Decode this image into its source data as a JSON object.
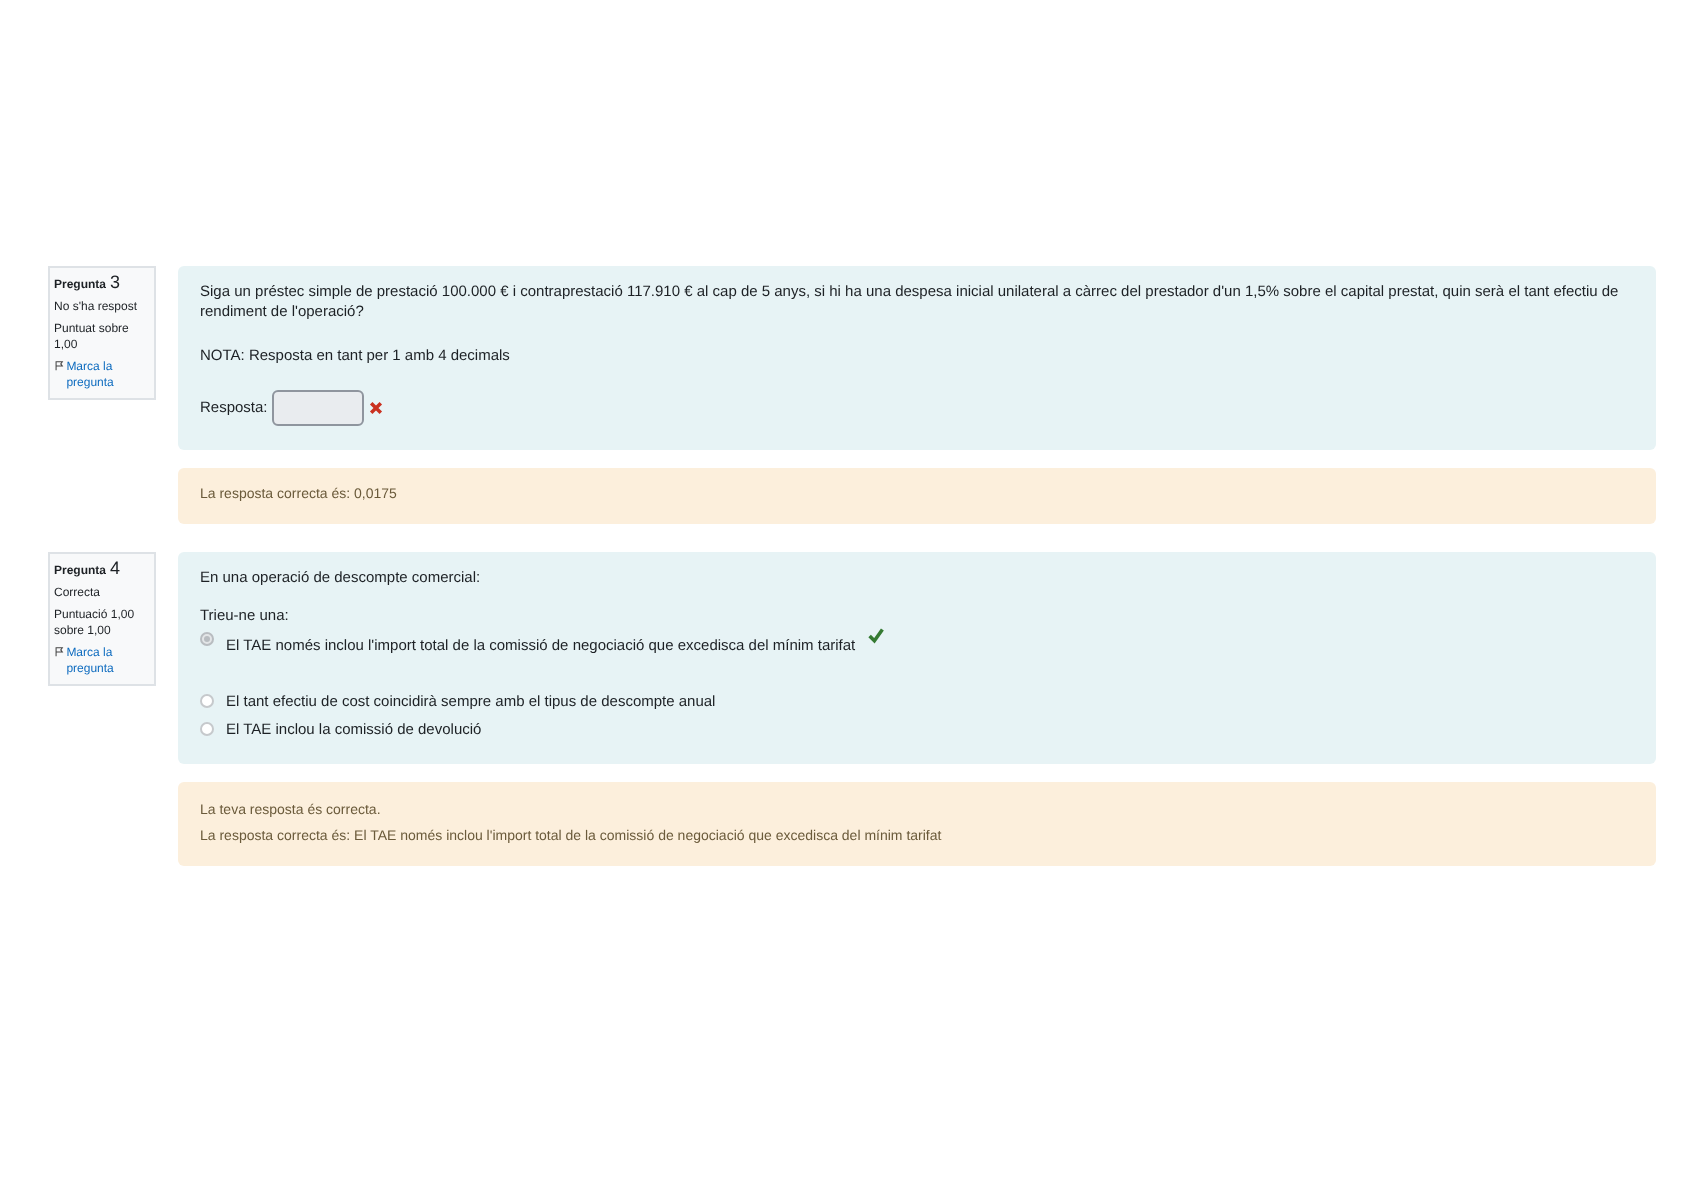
{
  "questions": [
    {
      "kind": "input",
      "label": "Pregunta",
      "number": "3",
      "state": "No s'ha respost",
      "grade": "Puntuat sobre 1,00",
      "flag": "Marca la pregunta",
      "text": [
        "Siga un préstec simple de prestació 100.000 € i contraprestació 117.910 € al cap de 5 anys, si hi ha una despesa inicial unilateral a càrrec del prestador d'un 1,5% sobre el capital prestat, quin serà el tant efectiu de rendiment de l'operació?",
        "NOTA: Resposta en tant per 1 amb 4 decimals"
      ],
      "answer": {
        "label": "Resposta:",
        "correct": false
      },
      "feedback": [
        "La resposta correcta és: 0,0175"
      ]
    },
    {
      "kind": "choice",
      "label": "Pregunta",
      "number": "4",
      "state": "Correcta",
      "grade": "Puntuació 1,00 sobre 1,00",
      "flag": "Marca la pregunta",
      "text": [
        "En una operació de descompte comercial:"
      ],
      "prompt": "Trieu-ne una:",
      "options": [
        {
          "text": "El TAE només inclou l'import total de la comissió de negociació que excedisca del mínim tarifat",
          "selected": true,
          "correct": true
        },
        {
          "text": "El tant efectiu de cost coincidirà sempre amb el tipus de descompte anual",
          "selected": false
        },
        {
          "text": "El TAE inclou la comissió de devolució",
          "selected": false
        }
      ],
      "feedback": [
        "La teva resposta és correcta.",
        "La resposta correcta és: El TAE només inclou l'import total de la comissió de negociació que excedisca del mínim tarifat"
      ]
    }
  ]
}
